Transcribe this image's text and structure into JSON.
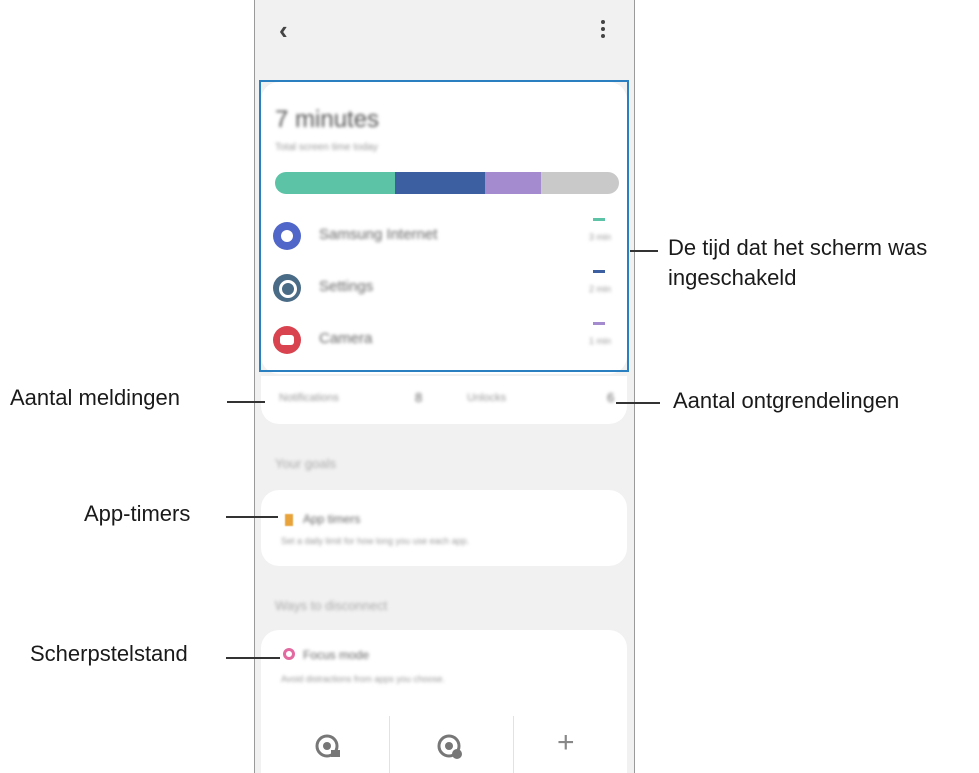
{
  "screen": {
    "headline": "7 minutes",
    "subheadline": "Total screen time today",
    "usage_bar_colors": [
      "#5cc3a7",
      "#3b5fa0",
      "#a48bd0",
      "#c9c9c9"
    ],
    "apps": [
      {
        "name": "Samsung Internet",
        "time": "3 min",
        "icon": "internet-icon",
        "color": "#5066c9"
      },
      {
        "name": "Settings",
        "time": "2 min",
        "icon": "settings-icon",
        "color": "#4a6b86"
      },
      {
        "name": "Camera",
        "time": "1 min",
        "icon": "camera-icon",
        "color": "#d9434f"
      }
    ],
    "stats": {
      "notifications_label": "Notifications",
      "notifications_value": "8",
      "unlocks_label": "Unlocks",
      "unlocks_value": "6"
    },
    "section_goals": "Your goals",
    "app_timers_title": "App timers",
    "app_timers_desc": "Set a daily limit for how long you use each app.",
    "section_modes": "Ways to disconnect",
    "focus_title": "Focus mode",
    "focus_desc": "Avoid distractions from apps you choose."
  },
  "callouts": {
    "screen_time": "De tijd dat het scherm was ingeschakeld",
    "notifications": "Aantal meldingen",
    "unlocks": "Aantal ontgrendelingen",
    "app_timers": "App-timers",
    "focus": "Scherpstelstand"
  },
  "accent": "#2a7fc0"
}
